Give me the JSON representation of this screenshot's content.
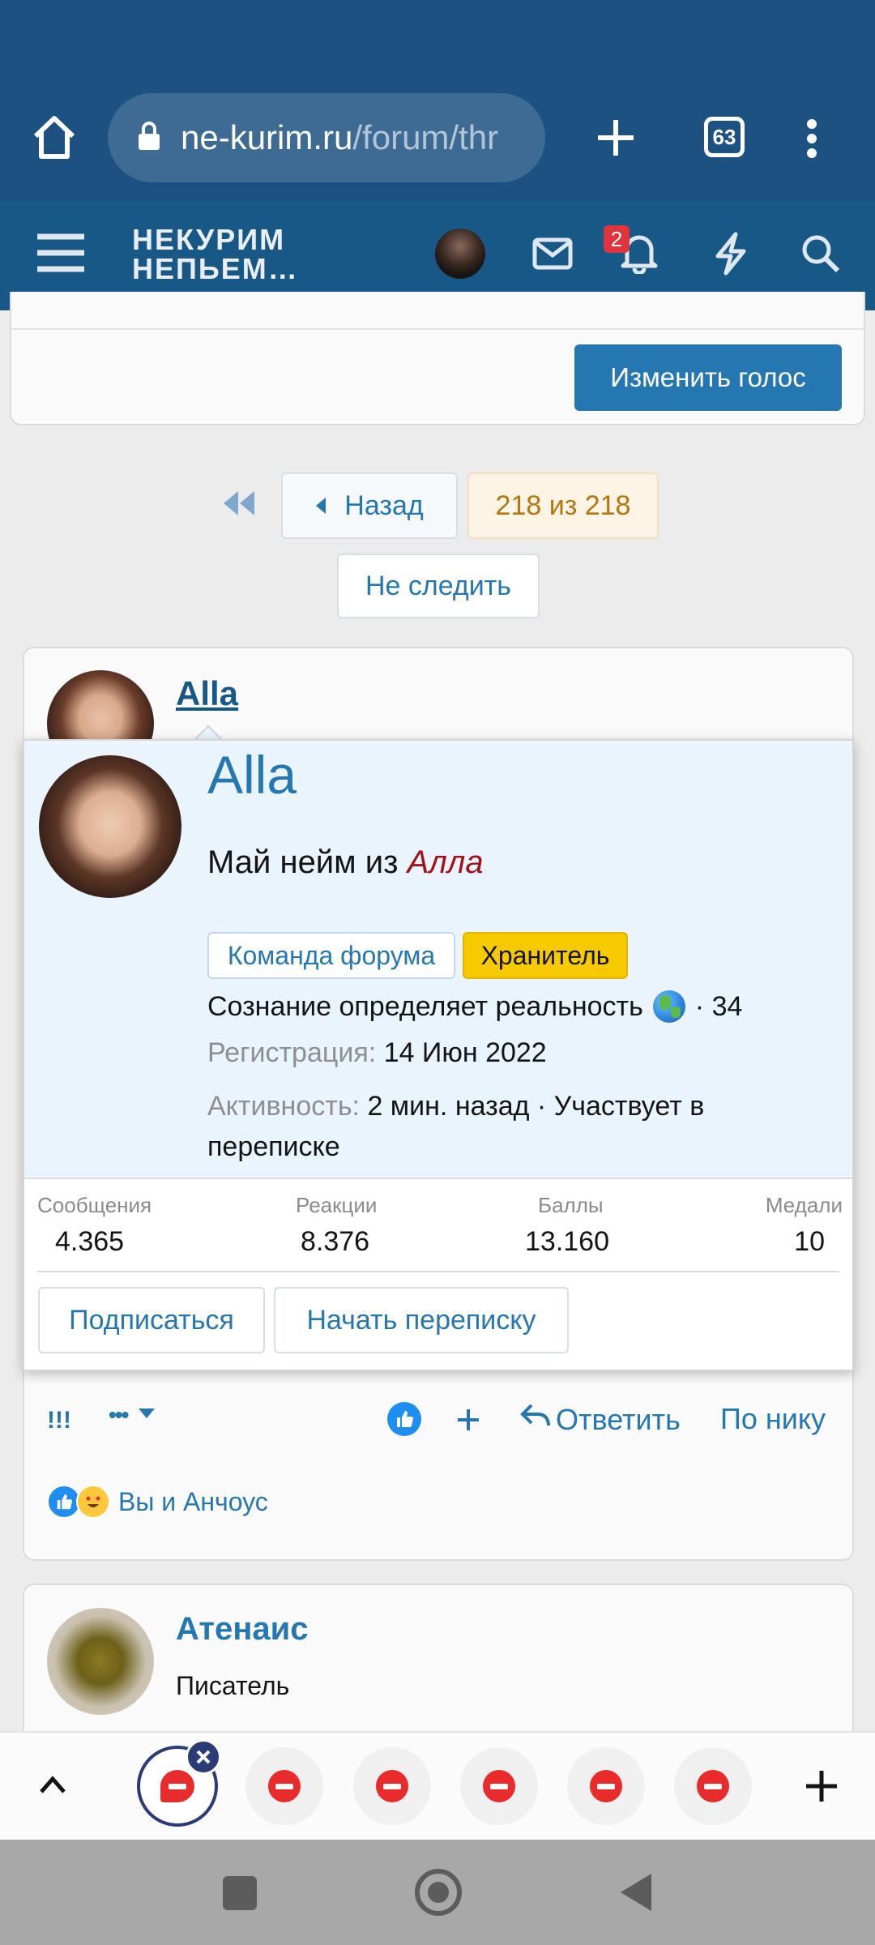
{
  "browser": {
    "url_host": "ne-kurim.ru",
    "url_path": "/forum/thr",
    "tab_count": "63",
    "icons": [
      "home-icon",
      "lock-icon",
      "plus-icon",
      "tabs-icon",
      "kebab-menu-icon"
    ]
  },
  "forum_header": {
    "logo_line1": "НЕКУРИМ",
    "logo_line2": "НЕПЬЕМ…",
    "alerts_count": "2",
    "icons": [
      "menu-icon",
      "avatar",
      "mail-icon",
      "bell-icon",
      "lightning-icon",
      "search-icon"
    ]
  },
  "poll": {
    "change_vote_label": "Изменить голос"
  },
  "pagination": {
    "back_label": "Назад",
    "page_status": "218 из 218",
    "unwatch_label": "Не следить"
  },
  "post": {
    "username": "Alla",
    "action_exclaim": "!!!",
    "action_more": "•••",
    "reply_label": "Ответить",
    "by_nick_label": "По нику",
    "reactions_text": "Вы и Анчоус"
  },
  "member_card": {
    "name": "Alla",
    "title_prefix": "Май нейм из ",
    "title_italic": "Алла",
    "badge_team": "Команда форума",
    "badge_role": "Хранитель",
    "status_text": "Сознание определяет реальность",
    "status_count": "· 34",
    "reg_label": "Регистрация:",
    "reg_value": "14 Июн 2022",
    "activity_label": "Активность:",
    "activity_value": "2 мин. назад · Участвует в",
    "activity_value2": "переписке",
    "stats": [
      {
        "label": "Сообщения",
        "value": "4.365"
      },
      {
        "label": "Реакции",
        "value": "8.376"
      },
      {
        "label": "Баллы",
        "value": "13.160"
      },
      {
        "label": "Медали",
        "value": "10"
      }
    ],
    "follow_label": "Подписаться",
    "message_label": "Начать переписку"
  },
  "next_post": {
    "username": "Атенаис",
    "user_title": "Писатель"
  },
  "colors": {
    "chrome_bg": "#1c5181",
    "forum_header_bg": "#185886",
    "accent_blue": "#2577b1",
    "role_badge_bg": "#f7c900",
    "alert_red": "#e0343d",
    "italic_red": "#a3121b"
  }
}
